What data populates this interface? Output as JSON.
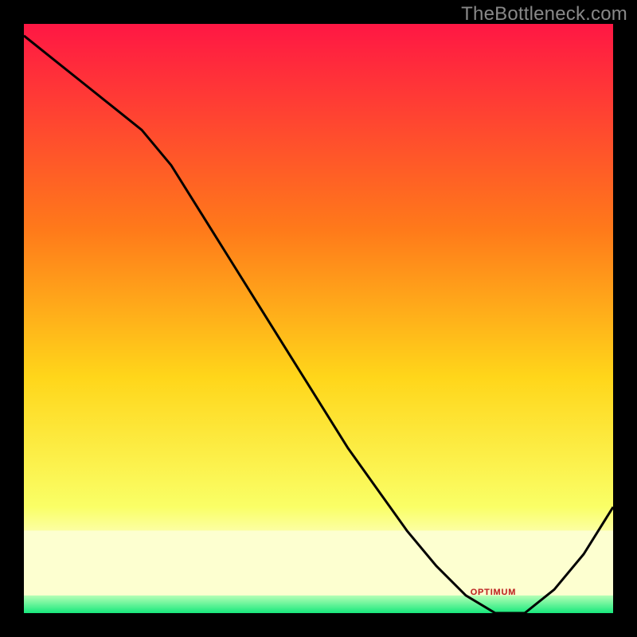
{
  "watermark": "TheBottleneck.com",
  "optimum_label": "OPTIMUM",
  "colors": {
    "gradient_top": "#ff1744",
    "gradient_mid_upper": "#ff7a1a",
    "gradient_mid": "#ffd61a",
    "gradient_mid_lower": "#faff66",
    "gradient_pale": "#fdffd0",
    "green_top": "#b6ffb6",
    "green_bottom": "#17e87c",
    "curve": "#000000",
    "optimum_text": "#c22222"
  },
  "chart_data": {
    "type": "line",
    "title": "",
    "xlabel": "",
    "ylabel": "",
    "xlim": [
      0,
      100
    ],
    "ylim": [
      0,
      100
    ],
    "x": [
      0,
      5,
      10,
      15,
      20,
      25,
      30,
      35,
      40,
      45,
      50,
      55,
      60,
      65,
      70,
      75,
      80,
      85,
      90,
      95,
      100
    ],
    "values": [
      98,
      94,
      90,
      86,
      82,
      76,
      68,
      60,
      52,
      44,
      36,
      28,
      21,
      14,
      8,
      3,
      0,
      0,
      4,
      10,
      18
    ],
    "optimum_x_range": [
      74,
      87
    ],
    "green_band_fraction": 0.03,
    "pale_band_fraction": 0.11,
    "grid": false,
    "legend": false
  }
}
